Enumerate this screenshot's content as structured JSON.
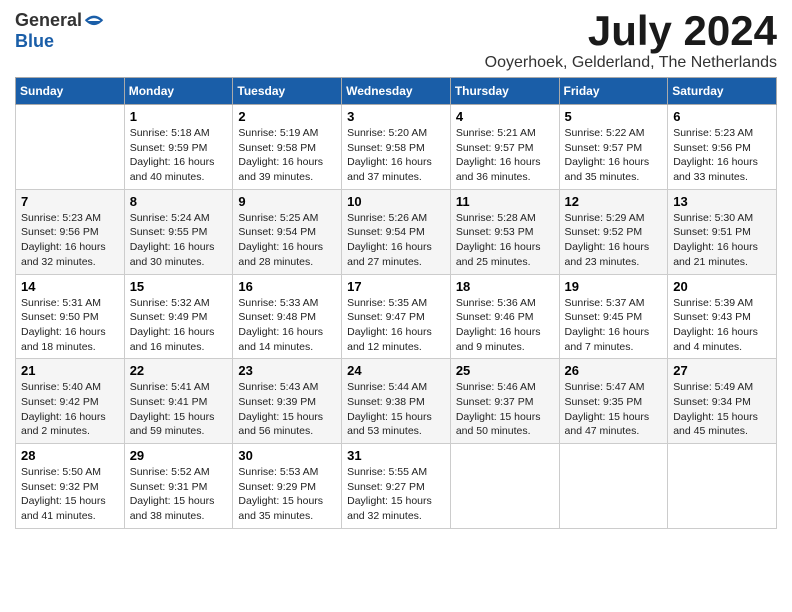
{
  "header": {
    "logo_general": "General",
    "logo_blue": "Blue",
    "month_title": "July 2024",
    "location": "Ooyerhoek, Gelderland, The Netherlands"
  },
  "days_of_week": [
    "Sunday",
    "Monday",
    "Tuesday",
    "Wednesday",
    "Thursday",
    "Friday",
    "Saturday"
  ],
  "weeks": [
    [
      {
        "day": "",
        "info": ""
      },
      {
        "day": "1",
        "info": "Sunrise: 5:18 AM\nSunset: 9:59 PM\nDaylight: 16 hours\nand 40 minutes."
      },
      {
        "day": "2",
        "info": "Sunrise: 5:19 AM\nSunset: 9:58 PM\nDaylight: 16 hours\nand 39 minutes."
      },
      {
        "day": "3",
        "info": "Sunrise: 5:20 AM\nSunset: 9:58 PM\nDaylight: 16 hours\nand 37 minutes."
      },
      {
        "day": "4",
        "info": "Sunrise: 5:21 AM\nSunset: 9:57 PM\nDaylight: 16 hours\nand 36 minutes."
      },
      {
        "day": "5",
        "info": "Sunrise: 5:22 AM\nSunset: 9:57 PM\nDaylight: 16 hours\nand 35 minutes."
      },
      {
        "day": "6",
        "info": "Sunrise: 5:23 AM\nSunset: 9:56 PM\nDaylight: 16 hours\nand 33 minutes."
      }
    ],
    [
      {
        "day": "7",
        "info": "Sunrise: 5:23 AM\nSunset: 9:56 PM\nDaylight: 16 hours\nand 32 minutes."
      },
      {
        "day": "8",
        "info": "Sunrise: 5:24 AM\nSunset: 9:55 PM\nDaylight: 16 hours\nand 30 minutes."
      },
      {
        "day": "9",
        "info": "Sunrise: 5:25 AM\nSunset: 9:54 PM\nDaylight: 16 hours\nand 28 minutes."
      },
      {
        "day": "10",
        "info": "Sunrise: 5:26 AM\nSunset: 9:54 PM\nDaylight: 16 hours\nand 27 minutes."
      },
      {
        "day": "11",
        "info": "Sunrise: 5:28 AM\nSunset: 9:53 PM\nDaylight: 16 hours\nand 25 minutes."
      },
      {
        "day": "12",
        "info": "Sunrise: 5:29 AM\nSunset: 9:52 PM\nDaylight: 16 hours\nand 23 minutes."
      },
      {
        "day": "13",
        "info": "Sunrise: 5:30 AM\nSunset: 9:51 PM\nDaylight: 16 hours\nand 21 minutes."
      }
    ],
    [
      {
        "day": "14",
        "info": "Sunrise: 5:31 AM\nSunset: 9:50 PM\nDaylight: 16 hours\nand 18 minutes."
      },
      {
        "day": "15",
        "info": "Sunrise: 5:32 AM\nSunset: 9:49 PM\nDaylight: 16 hours\nand 16 minutes."
      },
      {
        "day": "16",
        "info": "Sunrise: 5:33 AM\nSunset: 9:48 PM\nDaylight: 16 hours\nand 14 minutes."
      },
      {
        "day": "17",
        "info": "Sunrise: 5:35 AM\nSunset: 9:47 PM\nDaylight: 16 hours\nand 12 minutes."
      },
      {
        "day": "18",
        "info": "Sunrise: 5:36 AM\nSunset: 9:46 PM\nDaylight: 16 hours\nand 9 minutes."
      },
      {
        "day": "19",
        "info": "Sunrise: 5:37 AM\nSunset: 9:45 PM\nDaylight: 16 hours\nand 7 minutes."
      },
      {
        "day": "20",
        "info": "Sunrise: 5:39 AM\nSunset: 9:43 PM\nDaylight: 16 hours\nand 4 minutes."
      }
    ],
    [
      {
        "day": "21",
        "info": "Sunrise: 5:40 AM\nSunset: 9:42 PM\nDaylight: 16 hours\nand 2 minutes."
      },
      {
        "day": "22",
        "info": "Sunrise: 5:41 AM\nSunset: 9:41 PM\nDaylight: 15 hours\nand 59 minutes."
      },
      {
        "day": "23",
        "info": "Sunrise: 5:43 AM\nSunset: 9:39 PM\nDaylight: 15 hours\nand 56 minutes."
      },
      {
        "day": "24",
        "info": "Sunrise: 5:44 AM\nSunset: 9:38 PM\nDaylight: 15 hours\nand 53 minutes."
      },
      {
        "day": "25",
        "info": "Sunrise: 5:46 AM\nSunset: 9:37 PM\nDaylight: 15 hours\nand 50 minutes."
      },
      {
        "day": "26",
        "info": "Sunrise: 5:47 AM\nSunset: 9:35 PM\nDaylight: 15 hours\nand 47 minutes."
      },
      {
        "day": "27",
        "info": "Sunrise: 5:49 AM\nSunset: 9:34 PM\nDaylight: 15 hours\nand 45 minutes."
      }
    ],
    [
      {
        "day": "28",
        "info": "Sunrise: 5:50 AM\nSunset: 9:32 PM\nDaylight: 15 hours\nand 41 minutes."
      },
      {
        "day": "29",
        "info": "Sunrise: 5:52 AM\nSunset: 9:31 PM\nDaylight: 15 hours\nand 38 minutes."
      },
      {
        "day": "30",
        "info": "Sunrise: 5:53 AM\nSunset: 9:29 PM\nDaylight: 15 hours\nand 35 minutes."
      },
      {
        "day": "31",
        "info": "Sunrise: 5:55 AM\nSunset: 9:27 PM\nDaylight: 15 hours\nand 32 minutes."
      },
      {
        "day": "",
        "info": ""
      },
      {
        "day": "",
        "info": ""
      },
      {
        "day": "",
        "info": ""
      }
    ]
  ]
}
